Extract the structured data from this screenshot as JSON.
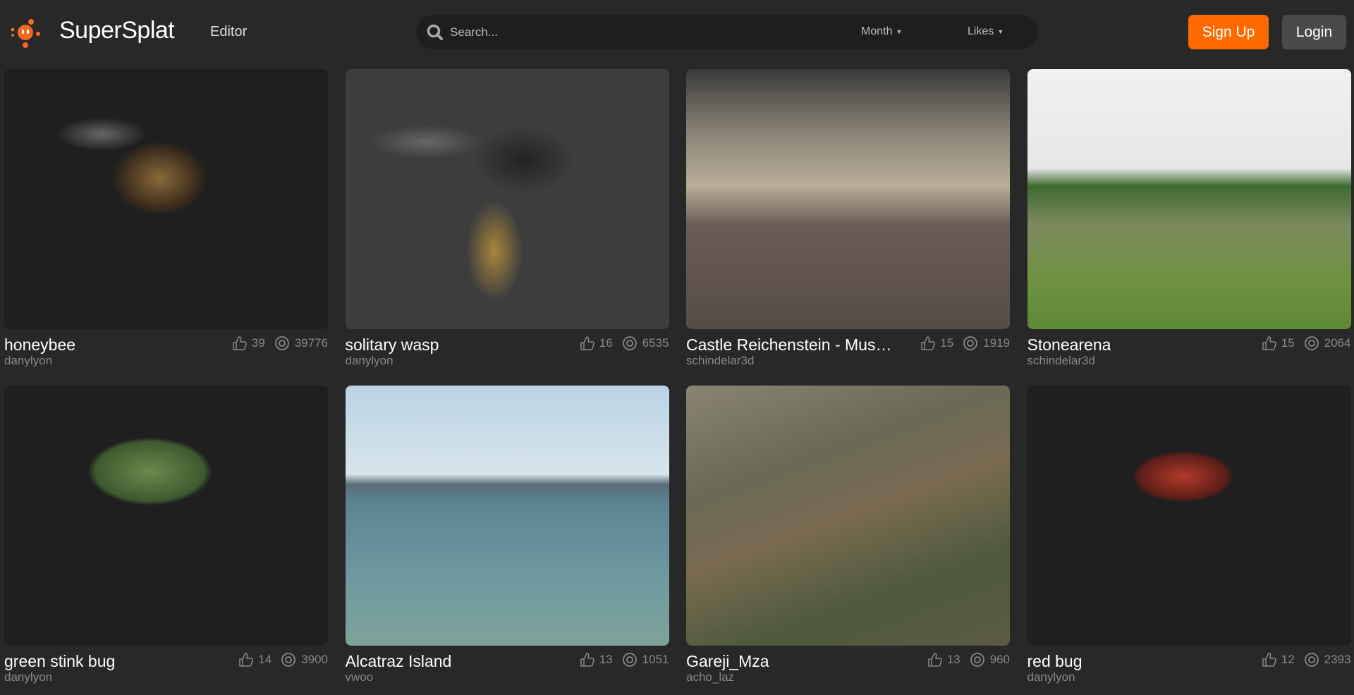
{
  "header": {
    "brand": "SuperSplat",
    "editor_link": "Editor",
    "search_placeholder": "Search...",
    "filters": [
      {
        "label": "Month"
      },
      {
        "label": "Likes"
      }
    ],
    "signup": "Sign Up",
    "login": "Login",
    "accent": "#ff6a00"
  },
  "cards": [
    {
      "title": "honeybee",
      "author": "danylyon",
      "likes": "39",
      "views": "39776"
    },
    {
      "title": "solitary wasp",
      "author": "danylyon",
      "likes": "16",
      "views": "6535"
    },
    {
      "title": "Castle Reichenstein - Museum",
      "author": "schindelar3d",
      "likes": "15",
      "views": "1919"
    },
    {
      "title": "Stonearena",
      "author": "schindelar3d",
      "likes": "15",
      "views": "2064"
    },
    {
      "title": "green stink bug",
      "author": "danylyon",
      "likes": "14",
      "views": "3900"
    },
    {
      "title": "Alcatraz Island",
      "author": "vwoo",
      "likes": "13",
      "views": "1051"
    },
    {
      "title": "Gareji_Mza",
      "author": "acho_laz",
      "likes": "13",
      "views": "960"
    },
    {
      "title": "red bug",
      "author": "danylyon",
      "likes": "12",
      "views": "2393"
    }
  ]
}
